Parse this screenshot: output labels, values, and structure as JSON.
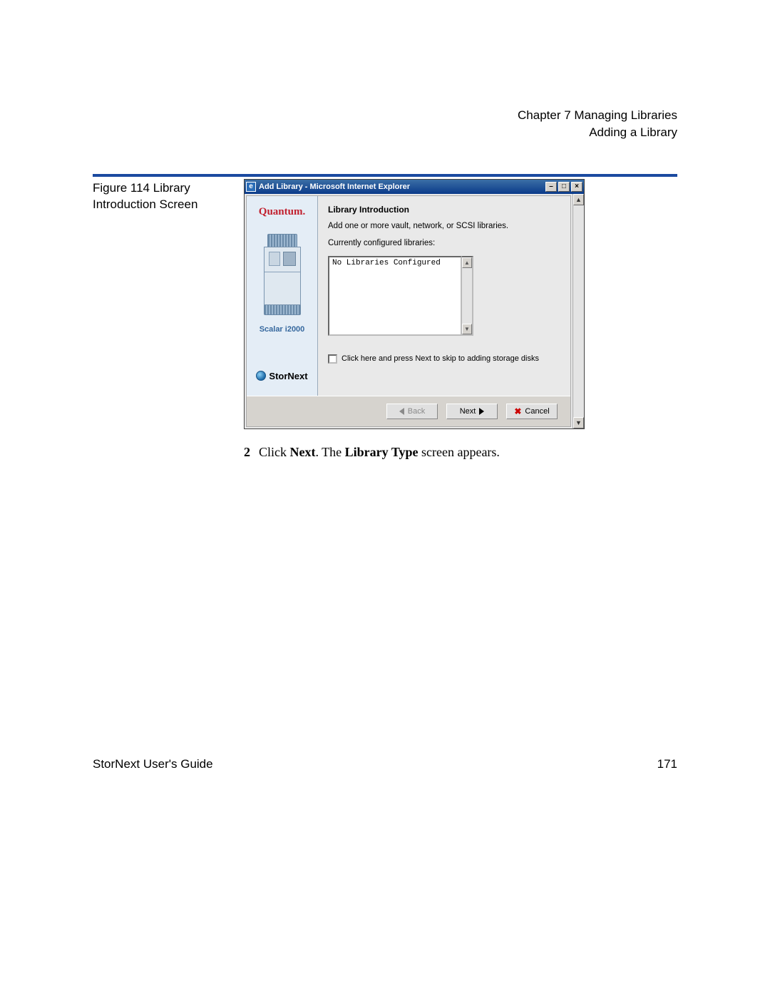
{
  "header": {
    "chapter": "Chapter 7  Managing Libraries",
    "section": "Adding a Library"
  },
  "figure_caption": "Figure 114  Library Introduction Screen",
  "window": {
    "title": "Add Library - Microsoft Internet Explorer",
    "sidebar": {
      "brand": "Quantum.",
      "device_label": "Scalar i2000",
      "product": "StorNext"
    },
    "main": {
      "heading": "Library Introduction",
      "intro": "Add one or more vault, network, or SCSI libraries.",
      "configured_label": "Currently configured libraries:",
      "listbox_value": "No Libraries Configured",
      "skip_label": "Click here and press Next to skip to adding storage disks"
    },
    "buttons": {
      "back": "Back",
      "next": "Next",
      "cancel": "Cancel"
    }
  },
  "instruction": {
    "num": "2",
    "pre": "Click ",
    "bold1": "Next",
    "mid": ". The ",
    "bold2": "Library Type",
    "post": " screen appears."
  },
  "footer": {
    "left": "StorNext User's Guide",
    "right": "171"
  }
}
